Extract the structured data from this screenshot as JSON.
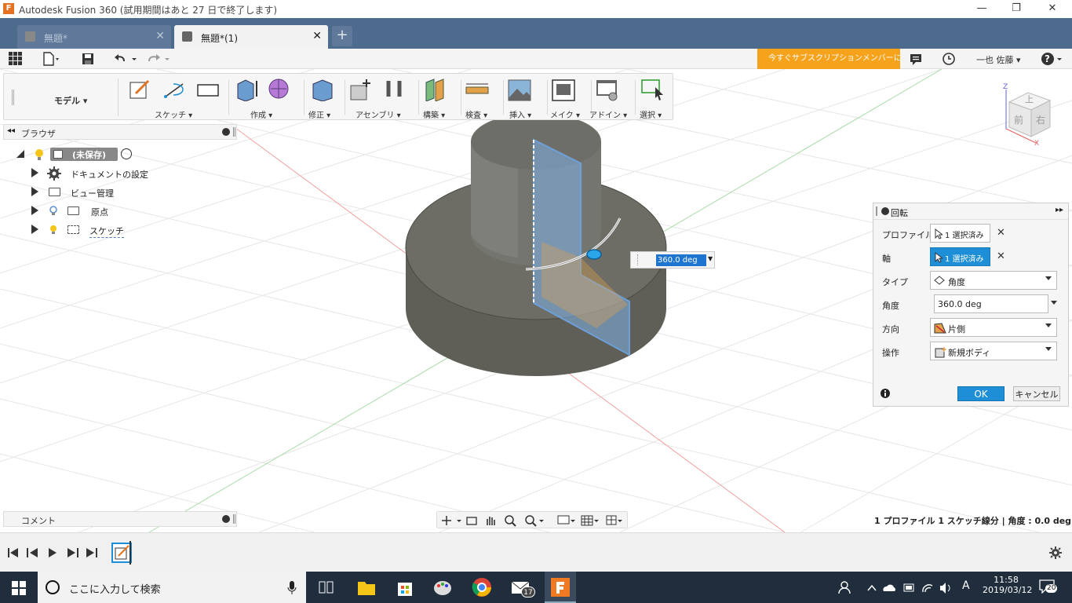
{
  "window": {
    "title": "Autodesk Fusion 360 (試用期間はあと 27 日で終了します)",
    "logo_letter": "F",
    "minimize": "—",
    "restore": "❐",
    "close": "✕"
  },
  "tabs": [
    {
      "label": "無題*",
      "close": "✕"
    },
    {
      "label": "無題*(1)",
      "close": "✕"
    }
  ],
  "tab_add": "+",
  "quickbar": {
    "promo": "今すぐサブスクリプションメンバーに...",
    "user": "一也 佐藤",
    "help": "?"
  },
  "toolbar": {
    "mode": "モデル",
    "groups": [
      {
        "label": "スケッチ"
      },
      {
        "label": "作成"
      },
      {
        "label": "修正"
      },
      {
        "label": "アセンブリ"
      },
      {
        "label": "構築"
      },
      {
        "label": "検査"
      },
      {
        "label": "挿入"
      },
      {
        "label": "メイク"
      },
      {
        "label": "アドイン"
      },
      {
        "label": "選択"
      }
    ]
  },
  "browser": {
    "title": "ブラウザ",
    "root": "(未保存)",
    "items": [
      {
        "label": "ドキュメントの設定"
      },
      {
        "label": "ビュー管理"
      },
      {
        "label": "原点"
      },
      {
        "label": "スケッチ"
      }
    ]
  },
  "comments": {
    "title": "コメント"
  },
  "viewcube": {
    "front": "前",
    "right": "右",
    "top": "上",
    "z": "Z",
    "x": "X"
  },
  "angle_input": {
    "value": "360.0 deg"
  },
  "dialog": {
    "title": "回転",
    "rows": [
      {
        "label": "プロファイル",
        "value": "1 選択済み"
      },
      {
        "label": "軸",
        "value": "1 選択済み"
      },
      {
        "label": "タイプ",
        "value": "角度"
      },
      {
        "label": "角度",
        "value": "360.0 deg"
      },
      {
        "label": "方向",
        "value": "片側"
      },
      {
        "label": "操作",
        "value": "新規ボディ"
      }
    ],
    "ok": "OK",
    "cancel": "キャンセル",
    "close_x": "✕"
  },
  "status_line": "1 プロファイル 1 スケッチ線分 | 角度 : 0.0 deg",
  "taskbar": {
    "search_placeholder": "ここに入力して検索",
    "time": "11:58",
    "date": "2019/03/12",
    "ime": "A",
    "notifications": "20",
    "mail_badge": "17"
  },
  "colors": {
    "accent": "#1e8fd6",
    "tabbar": "#4d6b8c",
    "promo": "#f7a21b",
    "body": "#6a6a64",
    "plane": "#6d9fd8"
  }
}
